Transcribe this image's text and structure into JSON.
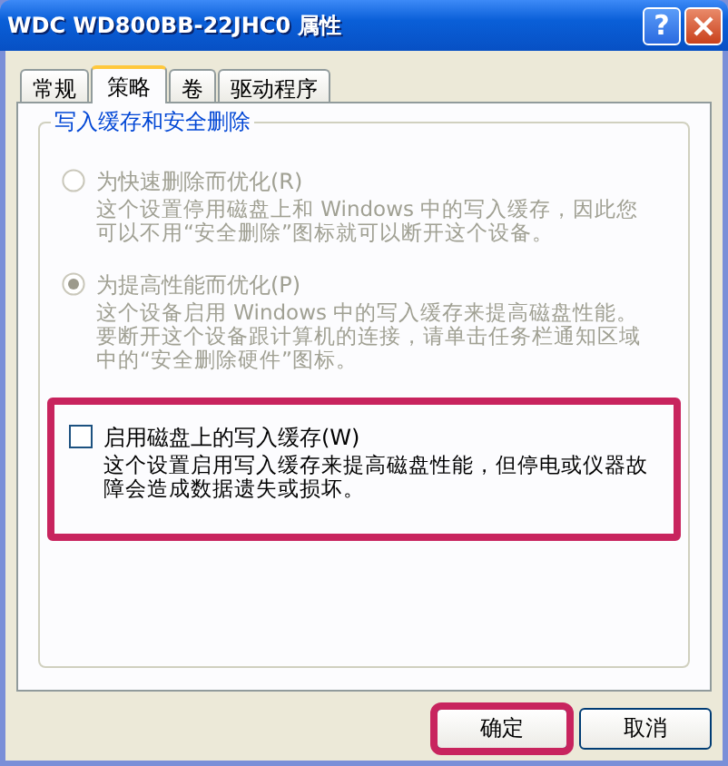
{
  "window": {
    "title": "WDC WD800BB-22JHC0 属性",
    "help": "?"
  },
  "tabs": [
    {
      "label": "常规",
      "selected": false
    },
    {
      "label": "策略",
      "selected": true
    },
    {
      "label": "卷",
      "selected": false
    },
    {
      "label": "驱动程序",
      "selected": false
    }
  ],
  "group": {
    "title": "写入缓存和安全删除",
    "options": [
      {
        "kind": "radio",
        "label": "为快速删除而优化(R)",
        "description": "这个设置停用磁盘上和 Windows 中的写入缓存，因此您可以不用“安全删除”图标就可以断开这个设备。",
        "selected": false,
        "disabled": true,
        "highlighted": false
      },
      {
        "kind": "radio",
        "label": "为提高性能而优化(P)",
        "description": "这个设备启用 Windows 中的写入缓存来提高磁盘性能。要断开这个设备跟计算机的连接，请单击任务栏通知区域中的“安全删除硬件”图标。",
        "selected": true,
        "disabled": true,
        "highlighted": false
      },
      {
        "kind": "checkbox",
        "label": "启用磁盘上的写入缓存(W)",
        "description": "这个设置启用写入缓存来提高磁盘性能，但停电或仪器故障会造成数据遗失或损坏。",
        "checked": false,
        "disabled": false,
        "highlighted": true
      }
    ]
  },
  "buttons": [
    {
      "label": "确定",
      "highlighted": true
    },
    {
      "label": "取消",
      "highlighted": false
    }
  ]
}
